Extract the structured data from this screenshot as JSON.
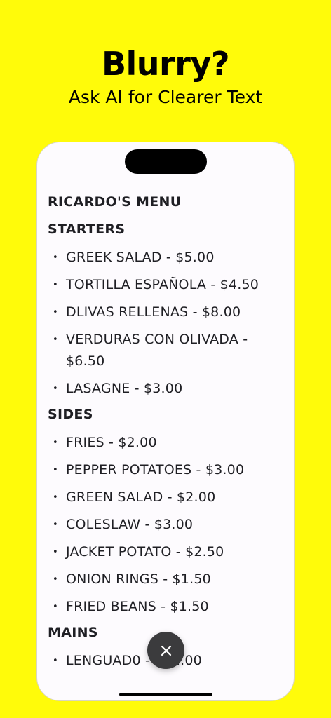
{
  "promo": {
    "headline": "Blurry?",
    "subheadline": "Ask AI for Clearer Text"
  },
  "menu": {
    "title": "RICARDO'S MENU",
    "sections": [
      {
        "title": "STARTERS",
        "items": [
          "GREEK SALAD - $5.00",
          "TORTILLA ESPAÑOLA - $4.50",
          "DLIVAS RELLENAS - $8.00",
          "VERDURAS CON OLIVADA - $6.50",
          "LASAGNE - $3.00"
        ]
      },
      {
        "title": "SIDES",
        "items": [
          "FRIES - $2.00",
          "PEPPER POTATOES - $3.00",
          "GREEN SALAD - $2.00",
          "COLESLAW - $3.00",
          "JACKET POTATO - $2.50",
          "ONION RINGS - $1.50",
          "FRIED BEANS - $1.50"
        ]
      },
      {
        "title": "MAINS",
        "items": [
          "LENGUAD0 - $12.00"
        ]
      }
    ]
  },
  "bullet_glyph": "•",
  "icons": {
    "close": "close-icon"
  },
  "colors": {
    "background": "#FFFB0A",
    "fab": "#3B3B3D",
    "text": "#1F1F24"
  }
}
